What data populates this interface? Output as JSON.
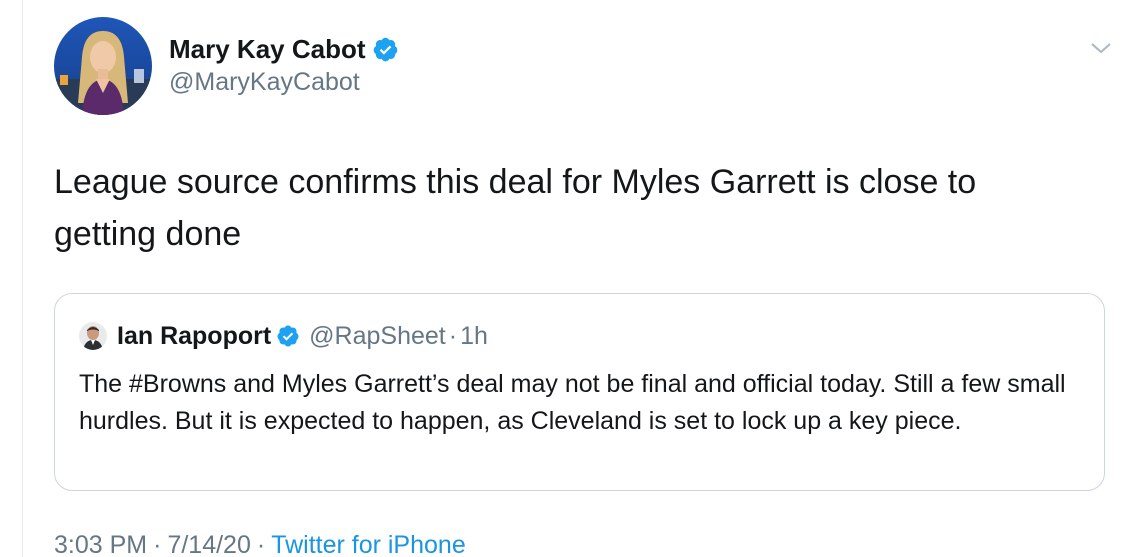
{
  "tweet": {
    "author": {
      "name": "Mary Kay Cabot",
      "handle": "@MaryKayCabot",
      "verified_icon": "verified-badge-icon",
      "avatar_icon": "profile-photo"
    },
    "menu_icon": "chevron-down-icon",
    "text": "League source confirms this deal for Myles Garrett is close to getting done",
    "quoted": {
      "name": "Ian Rapoport",
      "handle": "@RapSheet",
      "separator": "·",
      "time": "1h",
      "verified_icon": "verified-badge-icon",
      "text": "The #Browns and Myles Garrett’s deal may not be final and official today. Still a few small hurdles. But it is expected to happen, as Cleveland is set to lock up a key piece."
    },
    "meta": {
      "time": "3:03 PM",
      "separator": "·",
      "date": "7/14/20",
      "source": "Twitter for iPhone"
    }
  },
  "colors": {
    "verified": "#1da1f2",
    "link": "#1b95e0",
    "secondary_text": "#657786",
    "primary_text": "#14171a",
    "border": "#ccd6dd"
  }
}
